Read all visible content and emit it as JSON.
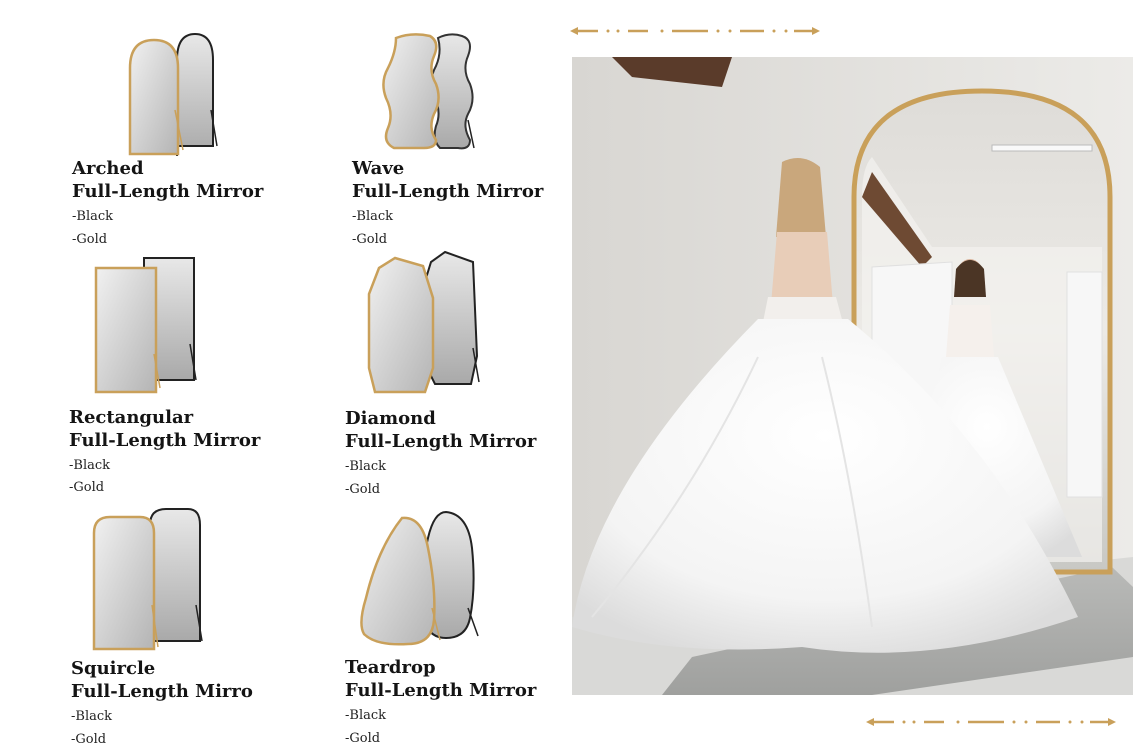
{
  "accent_color": "#c9a05a",
  "products": [
    {
      "name_line1": "Arched",
      "name_line2": "Full-Length Mirror",
      "options": [
        "-Black",
        "-Gold"
      ],
      "icon": "arched-mirror-icon"
    },
    {
      "name_line1": "Wave",
      "name_line2": "Full-Length Mirror",
      "options": [
        "-Black",
        "-Gold"
      ],
      "icon": "wave-mirror-icon"
    },
    {
      "name_line1": "Rectangular",
      "name_line2": "Full-Length Mirror",
      "options": [
        "-Black",
        "-Gold"
      ],
      "icon": "rectangular-mirror-icon"
    },
    {
      "name_line1": "Diamond",
      "name_line2": "Full-Length Mirror",
      "options": [
        "-Black",
        "-Gold"
      ],
      "icon": "diamond-mirror-icon"
    },
    {
      "name_line1": "Squircle",
      "name_line2": "Full-Length Mirro",
      "options": [
        "-Black",
        "-Gold"
      ],
      "icon": "squircle-mirror-icon"
    },
    {
      "name_line1": "Teardrop",
      "name_line2": "Full-Length Mirror",
      "options": [
        "-Black",
        "-Gold"
      ],
      "icon": "teardrop-mirror-icon"
    }
  ],
  "photo": {
    "icon": "bride-mirror-photo"
  }
}
